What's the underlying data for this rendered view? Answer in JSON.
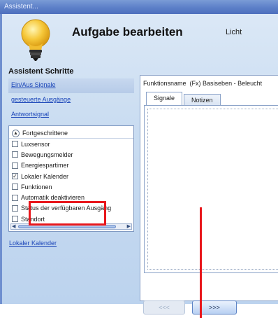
{
  "window": {
    "title": "Assistent..."
  },
  "header": {
    "title": "Aufgabe bearbeiten",
    "subtitle": "Licht",
    "icon": "lightbulb-icon"
  },
  "steps": {
    "title": "Assistent Schritte",
    "links": [
      {
        "label": "Ein/Aus Signale",
        "active": true
      },
      {
        "label": "gesteuerte Ausgänge",
        "active": false
      },
      {
        "label": "Antwortsignal",
        "active": false
      }
    ]
  },
  "advanced": {
    "title": "Fortgeschrittene",
    "items": [
      {
        "label": "Luxsensor",
        "checked": false
      },
      {
        "label": "Bewegungsmelder",
        "checked": false
      },
      {
        "label": "Energiespartimer",
        "checked": false
      },
      {
        "label": "Lokaler Kalender",
        "checked": true
      },
      {
        "label": "Funktionen",
        "checked": false
      },
      {
        "label": "Automatik deaktivieren",
        "checked": false
      },
      {
        "label": "Status der verfügbaren Ausgäng",
        "checked": false
      },
      {
        "label": "Standort",
        "checked": false
      }
    ]
  },
  "bottom_link": "Lokaler Kalender",
  "function": {
    "label": "Funktionsname",
    "value": "(Fx) Basiseben - Beleucht"
  },
  "tabs": [
    {
      "label": "Signale",
      "active": true
    },
    {
      "label": "Notizen",
      "active": false
    }
  ],
  "nav": {
    "prev": "<<<",
    "next": ">>>"
  },
  "colors": {
    "highlight": "#e8171c",
    "link": "#1a45b8",
    "titlebar": "#5c7fc8"
  }
}
